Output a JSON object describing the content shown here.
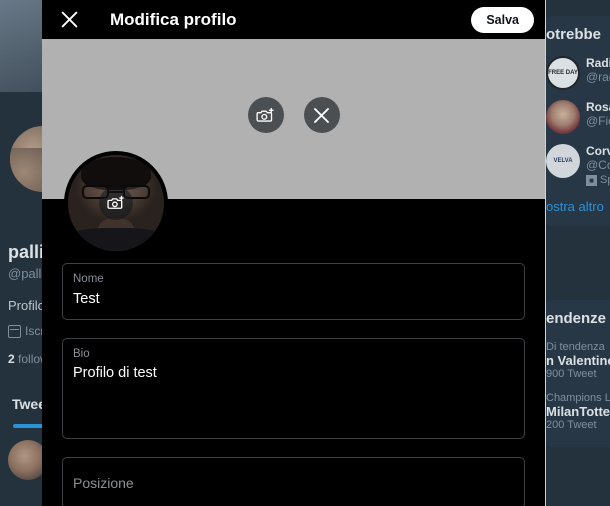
{
  "background": {
    "profile": {
      "name": "pallin",
      "handle": "@pallin",
      "bio": "Profilo d",
      "joined": "Iscri",
      "following_count": "2",
      "following_label": "follow",
      "tab_label": "Twee",
      "calendar_icon": "calendar-icon"
    },
    "who_to_follow": {
      "title": "otrebbe",
      "accounts": [
        {
          "avatar_text": "FREE DAY",
          "name": "Radi",
          "handle": "@rad",
          "promoted": ""
        },
        {
          "avatar_text": "",
          "name": "Rosa",
          "handle": "@Fio",
          "promoted": ""
        },
        {
          "avatar_text": "VELVA",
          "name": "Corv",
          "handle": "@Co",
          "promoted": "Sp",
          "promo_icon": "promoted-icon"
        }
      ],
      "show_more": "ostra altro"
    },
    "trends": {
      "title": "endenze",
      "items": [
        {
          "category": "Di tendenza",
          "name": "n Valentino",
          "count": "900 Tweet"
        },
        {
          "category": "Champions L",
          "name": "MilanTotten",
          "count": "200 Tweet"
        }
      ]
    }
  },
  "scrollbar": {
    "down_arrow_icon": "chevron-down-icon",
    "arrow_glyph": "▼"
  },
  "modal": {
    "close_icon": "close-icon",
    "title": "Modifica profilo",
    "save_label": "Salva",
    "banner": {
      "color": "#b1b1b1",
      "add_photo_icon": "camera-add-icon",
      "remove_photo_icon": "close-icon"
    },
    "avatar": {
      "change_photo_icon": "camera-add-icon"
    },
    "fields": [
      {
        "label": "Nome",
        "value": "Test",
        "placeholder": ""
      },
      {
        "label": "Bio",
        "value": "Profilo di test",
        "placeholder": ""
      },
      {
        "label": "",
        "value": "",
        "placeholder": "Posizione"
      }
    ]
  },
  "colors": {
    "accent_blue": "#1d9bf0",
    "modal_bg": "#000000",
    "page_bg": "#15202b",
    "card_bg": "#192734",
    "banner_gray": "#b1b1b1"
  }
}
